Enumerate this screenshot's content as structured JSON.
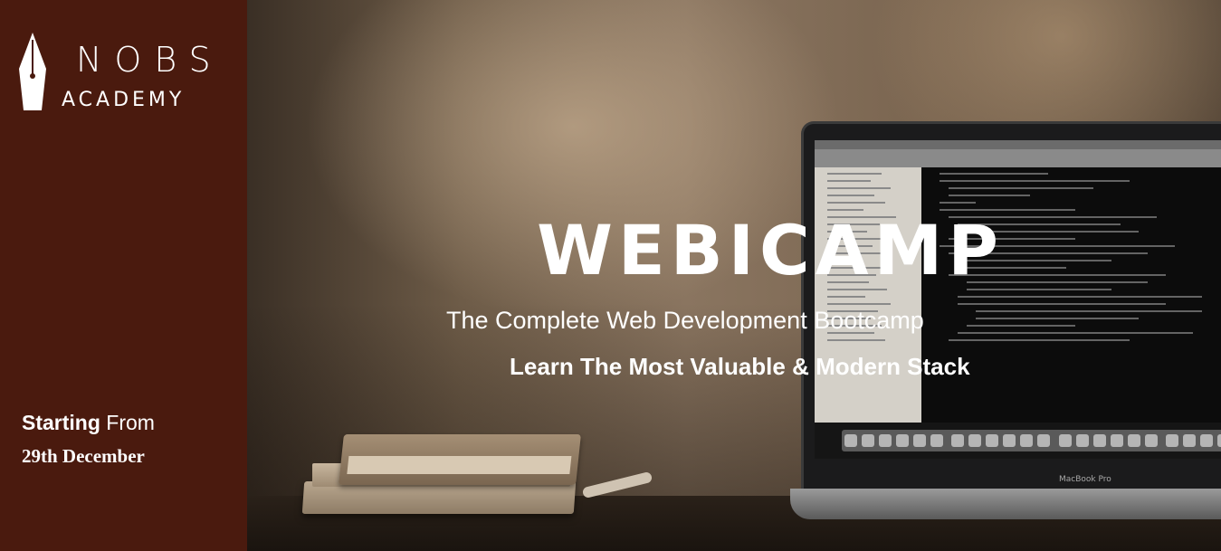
{
  "brand": {
    "name_line1": "NOBS",
    "name_line2": "ACADEMY",
    "logo_icon": "pen-nib-icon",
    "panel_color": "#4a1a0e"
  },
  "event": {
    "starting_bold": "Starting",
    "starting_rest": " From",
    "date": "29th December"
  },
  "hero": {
    "title": "WEBICAMP",
    "subtitle": "The Complete Web Development Bootcamp",
    "tagline": "Learn The Most Valuable & Modern Stack",
    "laptop_brand": "MacBook Pro"
  }
}
